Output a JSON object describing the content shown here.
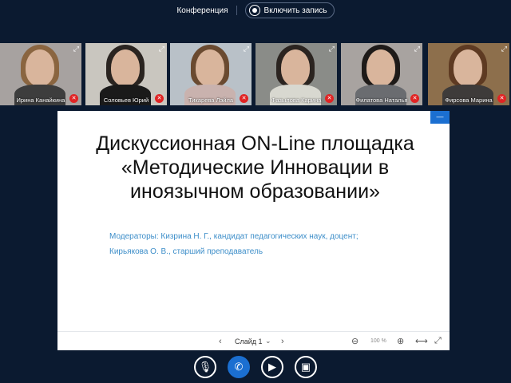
{
  "topbar": {
    "title": "Конференция",
    "record_label": "Включить запись"
  },
  "participants": [
    {
      "name": "Ирина Канайкина",
      "bg": "#a7a2a0",
      "hair": "#8a6540",
      "shirt": "#3d3d3d"
    },
    {
      "name": "Соловьев Юрий",
      "bg": "#c9c6bf",
      "hair": "#2a2420",
      "shirt": "#1a1a1a"
    },
    {
      "name": "Тикарева Лэйла",
      "bg": "#b9c1c8",
      "hair": "#6a4a30",
      "shirt": "#c9b2ae"
    },
    {
      "name": "Фазылова Карина",
      "bg": "#8a8c88",
      "hair": "#2b2420",
      "shirt": "#d8d8d0"
    },
    {
      "name": "Филатова Наталья",
      "bg": "#a8a3a0",
      "hair": "#1e1a18",
      "shirt": "#6a6c70"
    },
    {
      "name": "Фирсова Марина",
      "bg": "#8d6f4c",
      "hair": "#5e3a22",
      "shirt": "#3e3b3a"
    }
  ],
  "slide": {
    "title": "Дискуссионная ON-Line площадка «Методические Инновации в иноязычном образовании»",
    "moderators_line1": "Модераторы: Кизрина Н. Г., кандидат педагогических наук, доцент;",
    "moderators_line2": "Кирьякова О. В., старший преподаватель",
    "slide_label": "Слайд 1",
    "zoom": "100 %"
  },
  "colors": {
    "accent": "#1b6fd1",
    "background": "#0b1a30",
    "mic_muted": "#e02424"
  }
}
